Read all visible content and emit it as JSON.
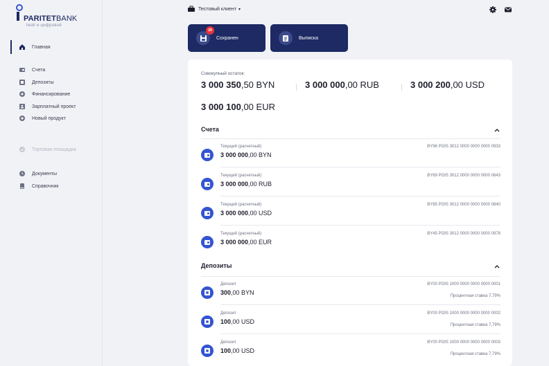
{
  "brand": {
    "name_bold": "PARITET",
    "name_light": "BANK",
    "tagline": "твой и цифровой"
  },
  "sidebar": {
    "items": [
      {
        "label": "Главная",
        "icon": "home-icon"
      },
      {
        "label": "Счета",
        "icon": "accounts-icon"
      },
      {
        "label": "Депозиты",
        "icon": "deposits-icon"
      },
      {
        "label": "Финансирование",
        "icon": "financing-icon"
      },
      {
        "label": "Зарплатный проект",
        "icon": "salary-icon"
      },
      {
        "label": "Новый продукт",
        "icon": "plus-icon"
      },
      {
        "label": "Торговая площадка",
        "icon": "marketplace-icon"
      },
      {
        "label": "Документы",
        "icon": "documents-icon"
      },
      {
        "label": "Справочник",
        "icon": "book-icon"
      }
    ]
  },
  "header": {
    "client": "Тестовый клиент",
    "client_caret": "▾"
  },
  "actions": {
    "saved": {
      "label": "Сохранен",
      "badge": "29"
    },
    "statement": {
      "label": "Выписка"
    }
  },
  "totals": {
    "label": "Совокупный остаток:",
    "items": [
      {
        "int": "3 000 350",
        "dec": ",50 BYN"
      },
      {
        "int": "3 000 000",
        "dec": ",00 RUB"
      },
      {
        "int": "3 000 200",
        "dec": ",00 USD"
      },
      {
        "int": "3 000 100",
        "dec": ",00 EUR"
      }
    ]
  },
  "accounts": {
    "title": "Счета",
    "rows": [
      {
        "type": "Текущий (расчетный)",
        "int": "3 000 000",
        "dec": ",00 BYN",
        "number": "BY96 POIS 3012 0000 0000 0000 0933"
      },
      {
        "type": "Текущий (расчетный)",
        "int": "3 000 000",
        "dec": ",00 RUB",
        "number": "BY69 POIS 3012 0000 0000 0000 0643"
      },
      {
        "type": "Текущий (расчетный)",
        "int": "3 000 000",
        "dec": ",00 USD",
        "number": "BY85 POIS 3012 0000 0000 0000 0840"
      },
      {
        "type": "Текущий (расчетный)",
        "int": "3 000 000",
        "dec": ",00 EUR",
        "number": "BY45 POIS 3012 0000 0000 0000 0978"
      }
    ]
  },
  "deposits": {
    "title": "Депозиты",
    "rows": [
      {
        "type": "Депозит",
        "int": "300",
        "dec": ",00 BYN",
        "number": "BY00 POIS 1000 0000 0000 0000 0001",
        "rate": "Процентная ставка 7,79%"
      },
      {
        "type": "Депозит",
        "int": "100",
        "dec": ",00 USD",
        "number": "BY00 POIS 1000 0000 0000 0000 0002",
        "rate": "Процентная ставка 7,79%"
      },
      {
        "type": "Депозит",
        "int": "100",
        "dec": ",00 USD",
        "number": "BY00 POIS 1000 0000 0000 0000 0003",
        "rate": "Процентная ставка 7,79%"
      }
    ]
  },
  "colors": {
    "brand": "#1d2a63",
    "accent": "#3454d1",
    "badge": "#e8323c"
  }
}
